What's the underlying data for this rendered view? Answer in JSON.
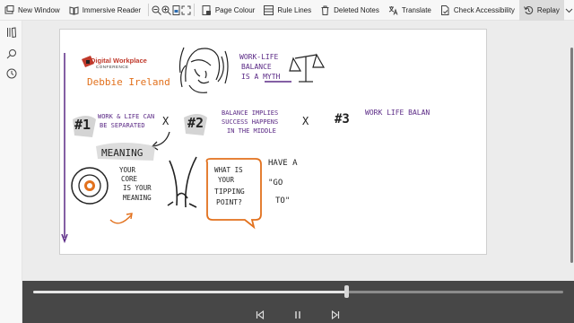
{
  "toolbar": {
    "new_window": "New Window",
    "immersive_reader": "Immersive Reader",
    "page_colour": "Page Colour",
    "rule_lines": "Rule Lines",
    "deleted_notes": "Deleted Notes",
    "translate": "Translate",
    "check_accessibility": "Check Accessibility",
    "replay": "Replay"
  },
  "sketch": {
    "logo_line1": "Digital Workplace",
    "logo_line2": "CONFERENCE",
    "speaker": "Debbie Ireland",
    "headline_1": "WORK-LIFE",
    "headline_2": "BALANCE",
    "headline_3a": "IS A ",
    "headline_3b": "MYTH",
    "num_1": "#1",
    "point_1a": "WORK & LIFE CAN",
    "point_1b": "BE SEPARATED",
    "num_2": "#2",
    "point_2a": "BALANCE IMPLIES",
    "point_2b": "SUCCESS HAPPENS",
    "point_2c": "IN THE MIDDLE",
    "num_3": "#3",
    "point_3": "WORK LIFE BALAN",
    "cross": "X",
    "meaning": "MEANING",
    "core_1": "YOUR",
    "core_2": "CORE",
    "core_3": "IS YOUR",
    "core_4": "MEANING",
    "tip_1": "WHAT IS",
    "tip_2": "YOUR",
    "tip_3": "TIPPING",
    "tip_4": "POINT?",
    "goto_1": "HAVE A",
    "goto_2": "\"GO",
    "goto_3": "TO\""
  },
  "replay": {
    "progress": 0.59
  },
  "colors": {
    "purple": "#5b2a86",
    "orange": "#e2711d",
    "replay_bg": "#474747"
  }
}
